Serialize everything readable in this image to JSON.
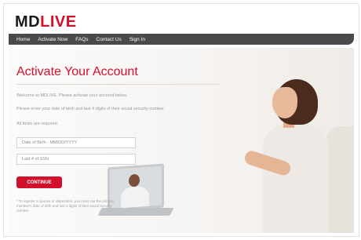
{
  "brand": {
    "logo_md": "MD",
    "logo_live": "LIVE"
  },
  "nav": {
    "items": [
      {
        "label": "Home"
      },
      {
        "label": "Activate Now"
      },
      {
        "label": "FAQs"
      },
      {
        "label": "Contact Us"
      },
      {
        "label": "Sign In"
      }
    ]
  },
  "main": {
    "title": "Activate Your Account",
    "welcome": "Welcome to MDLIVE. Please activate your account below.",
    "instructions": "Please enter your date of birth and last 4 digits of their social security number.",
    "required_note": "All fields are required.",
    "dob_placeholder": "Date of Birth - MM/DD/YYYY",
    "ssn_placeholder": "Last 4 of SSN",
    "continue_label": "CONTINUE",
    "footnote": "* To register a spouse or dependent, you must use the primary member's date of birth and last 4 digits of their social security number."
  },
  "colors": {
    "brand_red": "#d3102b",
    "nav_bg": "#4a4a4a"
  },
  "icons": {
    "hero_image": "woman-video-call-illustration"
  }
}
